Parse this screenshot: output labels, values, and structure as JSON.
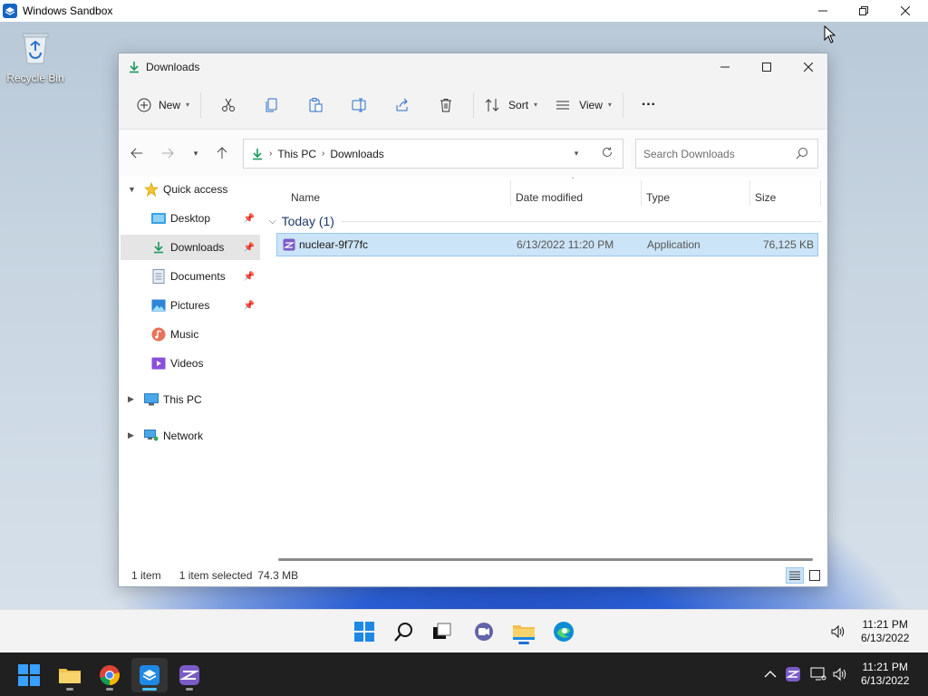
{
  "host": {
    "title": "Windows Sandbox",
    "clock_time": "11:21 PM",
    "clock_date": "6/13/2022"
  },
  "desktop": {
    "recycle_bin_label": "Recycle Bin"
  },
  "explorer": {
    "title": "Downloads",
    "toolbar": {
      "new_label": "New",
      "sort_label": "Sort",
      "view_label": "View",
      "more_label": "···"
    },
    "breadcrumb": [
      "This PC",
      "Downloads"
    ],
    "search_placeholder": "Search Downloads",
    "sidebar": {
      "quick_access": "Quick access",
      "items": [
        {
          "label": "Desktop"
        },
        {
          "label": "Downloads"
        },
        {
          "label": "Documents"
        },
        {
          "label": "Pictures"
        },
        {
          "label": "Music"
        },
        {
          "label": "Videos"
        }
      ],
      "this_pc": "This PC",
      "network": "Network"
    },
    "columns": {
      "name": "Name",
      "date": "Date modified",
      "type": "Type",
      "size": "Size"
    },
    "group_label": "Today (1)",
    "files": [
      {
        "name": "nuclear-9f77fc",
        "date": "6/13/2022 11:20 PM",
        "type": "Application",
        "size": "76,125 KB"
      }
    ],
    "status": {
      "count": "1 item",
      "selected": "1 item selected",
      "size": "74.3 MB"
    }
  },
  "guest_taskbar": {
    "clock_time": "11:21 PM",
    "clock_date": "6/13/2022"
  },
  "colors": {
    "accent": "#0067c0",
    "selection": "#cce4f7",
    "folder": "#f2c14e"
  }
}
